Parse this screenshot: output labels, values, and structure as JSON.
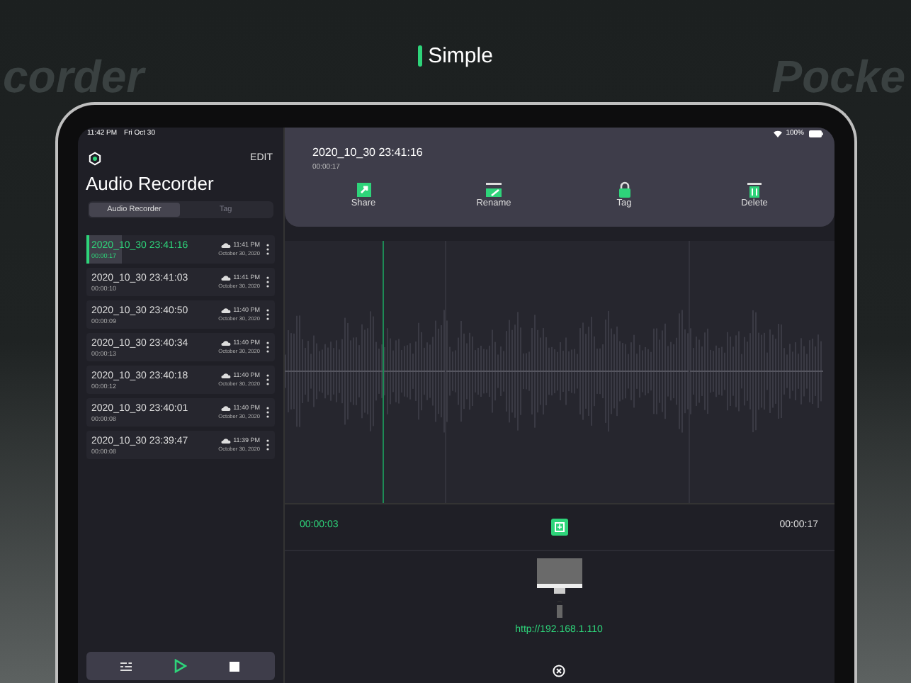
{
  "headline": "Simple",
  "background_words": [
    "corder",
    "Pocke"
  ],
  "status_bar": {
    "time": "11:42 PM",
    "date": "Fri Oct 30",
    "battery": "100%"
  },
  "sidebar": {
    "edit": "EDIT",
    "title": "Audio Recorder",
    "segments": [
      {
        "label": "Audio Recorder",
        "selected": true
      },
      {
        "label": "Tag",
        "selected": false
      }
    ],
    "recordings": [
      {
        "name": "2020_10_30 23:41:16",
        "duration": "00:00:17",
        "time": "11:41 PM",
        "date": "October 30, 2020",
        "selected": true
      },
      {
        "name": "2020_10_30 23:41:03",
        "duration": "00:00:10",
        "time": "11:41 PM",
        "date": "October 30, 2020",
        "selected": false
      },
      {
        "name": "2020_10_30 23:40:50",
        "duration": "00:00:09",
        "time": "11:40 PM",
        "date": "October 30, 2020",
        "selected": false
      },
      {
        "name": "2020_10_30 23:40:34",
        "duration": "00:00:13",
        "time": "11:40 PM",
        "date": "October 30, 2020",
        "selected": false
      },
      {
        "name": "2020_10_30 23:40:18",
        "duration": "00:00:12",
        "time": "11:40 PM",
        "date": "October 30, 2020",
        "selected": false
      },
      {
        "name": "2020_10_30 23:40:01",
        "duration": "00:00:08",
        "time": "11:40 PM",
        "date": "October 30, 2020",
        "selected": false
      },
      {
        "name": "2020_10_30 23:39:47",
        "duration": "00:00:08",
        "time": "11:39 PM",
        "date": "October 30, 2020",
        "selected": false
      }
    ]
  },
  "detail": {
    "name": "2020_10_30 23:41:16",
    "duration": "00:00:17",
    "actions": [
      {
        "kind": "share",
        "label": "Share"
      },
      {
        "kind": "rename",
        "label": "Rename"
      },
      {
        "kind": "tag",
        "label": "Tag"
      },
      {
        "kind": "delete",
        "label": "Delete"
      }
    ],
    "playback": {
      "level": 0.18,
      "elapsed": "00:00:03",
      "total": "00:00:17"
    },
    "transfer_url": "http://192.168.1.110"
  }
}
